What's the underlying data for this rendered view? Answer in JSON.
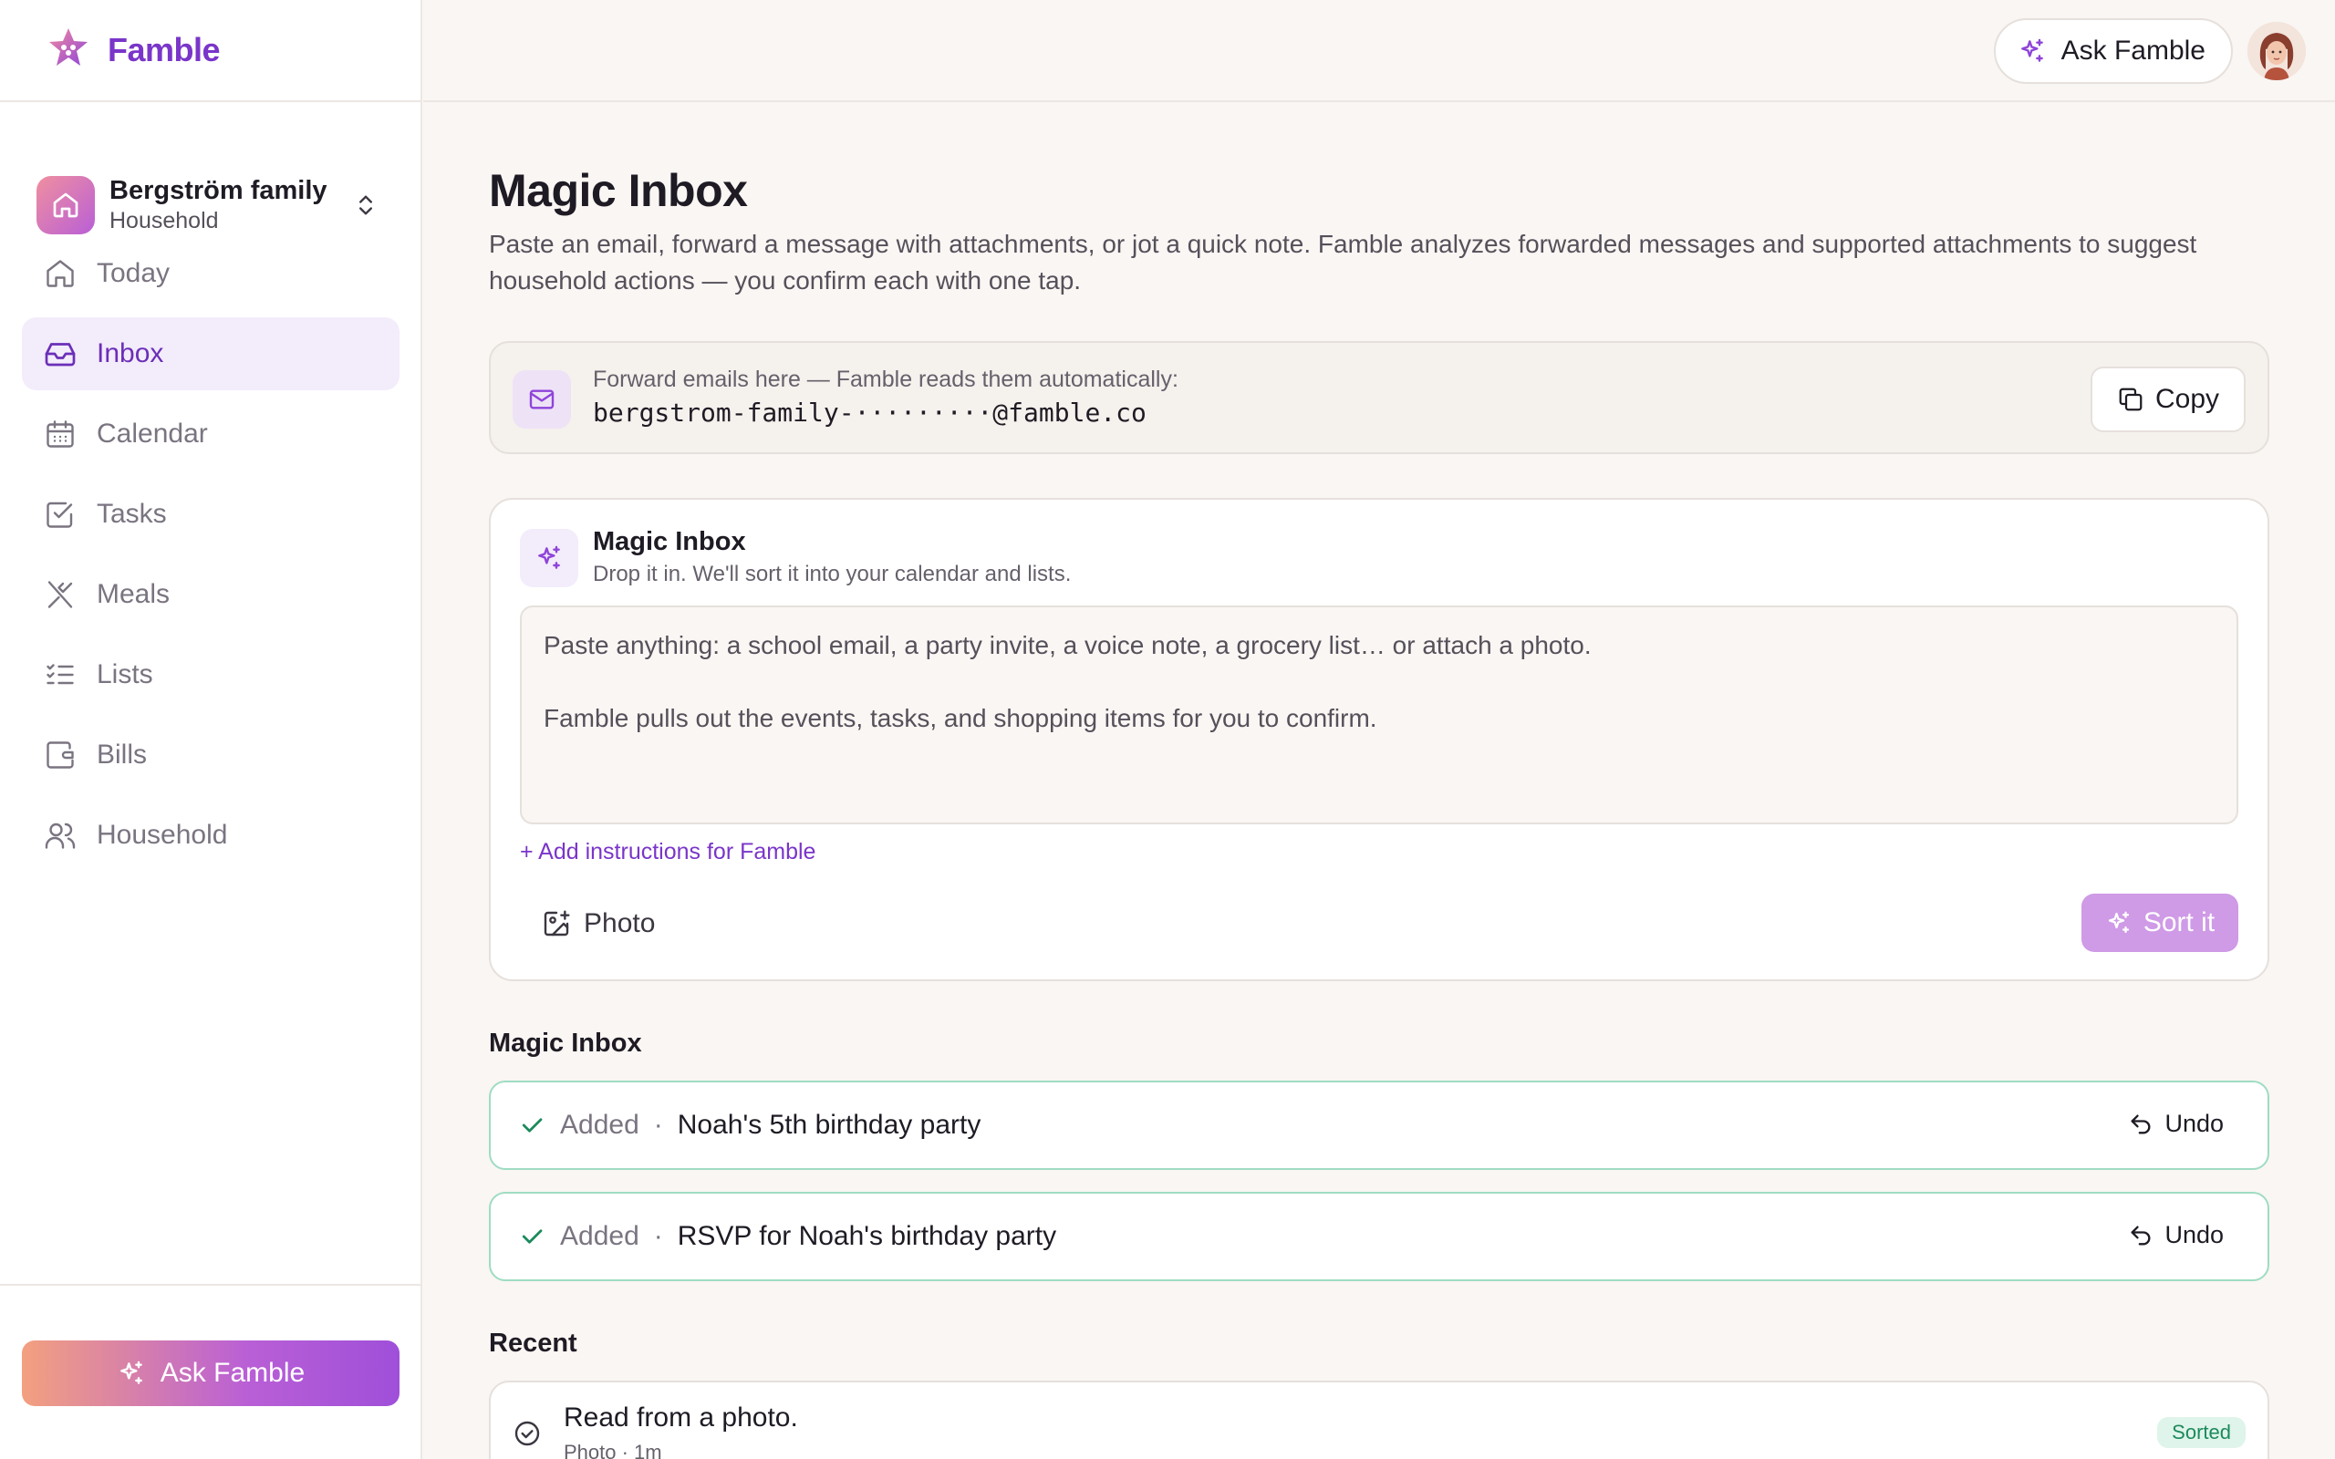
{
  "brand": {
    "name": "Famble"
  },
  "household": {
    "name": "Bergström family",
    "type": "Household"
  },
  "nav": [
    {
      "label": "Today",
      "icon": "home-icon"
    },
    {
      "label": "Inbox",
      "icon": "inbox-icon",
      "active": true
    },
    {
      "label": "Calendar",
      "icon": "calendar-icon"
    },
    {
      "label": "Tasks",
      "icon": "checkbox-icon"
    },
    {
      "label": "Meals",
      "icon": "utensils-icon"
    },
    {
      "label": "Lists",
      "icon": "list-icon"
    },
    {
      "label": "Bills",
      "icon": "wallet-icon"
    },
    {
      "label": "Household",
      "icon": "users-icon"
    }
  ],
  "ask_label": "Ask Famble",
  "page": {
    "title": "Magic Inbox",
    "subtitle": "Paste an email, forward a message with attachments, or jot a quick note. Famble analyzes forwarded messages and supported attachments to suggest household actions — you confirm each with one tap."
  },
  "forward": {
    "label": "Forward emails here — Famble reads them automatically:",
    "address": "bergstrom-family-·········@famble.co",
    "copy_label": "Copy"
  },
  "composer": {
    "title": "Magic Inbox",
    "subtitle": "Drop it in. We'll sort it into your calendar and lists.",
    "placeholder": "Paste anything: a school email, a party invite, a voice note, a grocery list… or attach a photo.\n\nFamble pulls out the events, tasks, and shopping items for you to confirm.",
    "add_instructions": "+ Add instructions for Famble",
    "photo_label": "Photo",
    "sort_label": "Sort it"
  },
  "results": {
    "heading": "Magic Inbox",
    "items": [
      {
        "status": "Added",
        "name": "Noah's 5th birthday party",
        "undo": "Undo"
      },
      {
        "status": "Added",
        "name": "RSVP for Noah's birthday party",
        "undo": "Undo"
      }
    ]
  },
  "recent": {
    "heading": "Recent",
    "items": [
      {
        "title": "Read from a photo.",
        "meta": "Photo · 1m",
        "badge": "Sorted"
      }
    ]
  },
  "colors": {
    "accent": "#7a35c9",
    "active_bg": "#f3ecfb",
    "success_border": "#9fdcc3",
    "success_text": "#1c8a5c"
  }
}
